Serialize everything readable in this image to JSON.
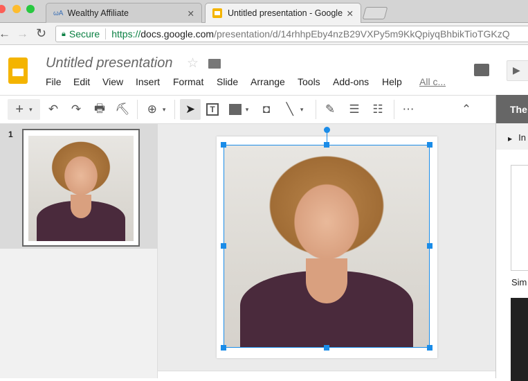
{
  "browser": {
    "tabs": [
      {
        "label": "Wealthy Affiliate",
        "favicon": "wa-icon"
      },
      {
        "label": "Untitled presentation - Google",
        "favicon": "slides-icon"
      }
    ],
    "secure_label": "Secure",
    "url_scheme": "https://",
    "url_host": "docs.google.com",
    "url_path": "/presentation/d/14rhhpEby4nzB29VXPy5m9KkQpiyqBhbikTioTGKzQ"
  },
  "app": {
    "title": "Untitled presentation",
    "menu": [
      "File",
      "Edit",
      "View",
      "Insert",
      "Format",
      "Slide",
      "Arrange",
      "Tools",
      "Add-ons",
      "Help"
    ],
    "all_changes": "All c..."
  },
  "filmstrip": {
    "slide_number": "1"
  },
  "panel": {
    "header": "The",
    "section": "In",
    "theme_label": "Sim"
  },
  "colors": {
    "accent": "#1a8ce8",
    "slides_yellow": "#f4b400"
  }
}
